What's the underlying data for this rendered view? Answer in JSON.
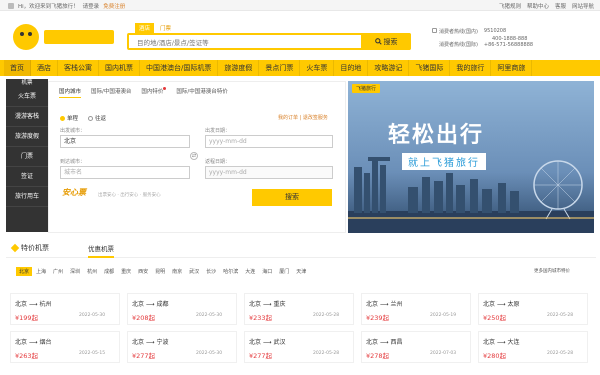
{
  "topbar": {
    "greeting": "Hi，欢迎来到飞猪旅行！",
    "login": "请登录",
    "register": "免费注册",
    "links": [
      "飞猪规则",
      "帮助中心",
      "客服",
      "网站导航"
    ]
  },
  "search": {
    "tabs": [
      "酒店",
      "门票"
    ],
    "placeholder": "目的地/酒店/景点/签证等",
    "button": "搜索"
  },
  "hotline": {
    "label1": "消费者热线(国内)",
    "num1": "9510208",
    "num2": "400-1888-888",
    "label2": "消费者热线(国际)",
    "num3": "+86-571-56888888"
  },
  "nav": [
    "首页",
    "酒店",
    "客栈公寓",
    "国内机票",
    "中国港澳台/国际机票",
    "旅游度假",
    "景点门票",
    "火车票",
    "目的地",
    "攻略游记",
    "飞猪国际",
    "我的旅行",
    "阿里商旅"
  ],
  "categories": {
    "title": "机票",
    "items": [
      "火车票",
      "漫游客栈",
      "旅游度假",
      "门票",
      "签证",
      "旅行用车"
    ]
  },
  "booking": {
    "tabs": [
      "国内城市",
      "国际/中国港澳台",
      "国内特价",
      "国际/中国港澳台特价"
    ],
    "trip_one": "单程",
    "trip_round": "往返",
    "order_links": "我的订单 | 退改签服务",
    "depart_city_label": "出发城市：",
    "depart_city": "北京",
    "depart_date_label": "出发日期：",
    "depart_date_ph": "yyyy-mm-dd",
    "arrive_city_label": "到达城市：",
    "arrive_city_ph": "城市名",
    "return_date_label": "返程日期：",
    "return_date_ph": "yyyy-mm-dd",
    "anxin": "安心票",
    "anxin_sub": "出票安心 · 出行安心 · 服务安心",
    "submit": "搜索"
  },
  "banner": {
    "brand": "飞猪旅行",
    "title": "轻松出行",
    "subtitle": "就上飞猪旅行"
  },
  "deals": {
    "title": "特价机票",
    "tab": "优惠机票",
    "cities": [
      "北京",
      "上海",
      "广州",
      "深圳",
      "杭州",
      "成都",
      "重庆",
      "西安",
      "昆明",
      "南京",
      "武汉",
      "长沙",
      "哈尔滨",
      "大连",
      "海口",
      "厦门",
      "天津"
    ],
    "more": "更多国内城市特价",
    "cards": [
      {
        "from": "北京",
        "to": "杭州",
        "price": "¥199起",
        "date": "2022-05-30"
      },
      {
        "from": "北京",
        "to": "成都",
        "price": "¥208起",
        "date": "2022-05-30"
      },
      {
        "from": "北京",
        "to": "重庆",
        "price": "¥233起",
        "date": "2022-05-28"
      },
      {
        "from": "北京",
        "to": "兰州",
        "price": "¥239起",
        "date": "2022-05-19"
      },
      {
        "from": "北京",
        "to": "太原",
        "price": "¥250起",
        "date": "2022-05-28"
      },
      {
        "from": "北京",
        "to": "烟台",
        "price": "¥263起",
        "date": "2022-05-15"
      },
      {
        "from": "北京",
        "to": "宁波",
        "price": "¥277起",
        "date": "2022-05-30"
      },
      {
        "from": "北京",
        "to": "武汉",
        "price": "¥277起",
        "date": "2022-05-28"
      },
      {
        "from": "北京",
        "to": "西昌",
        "price": "¥278起",
        "date": "2022-07-03"
      },
      {
        "from": "北京",
        "to": "大连",
        "price": "¥280起",
        "date": "2022-05-28"
      }
    ]
  },
  "colors": {
    "accent": "#ffc900",
    "price": "#e4393c"
  }
}
